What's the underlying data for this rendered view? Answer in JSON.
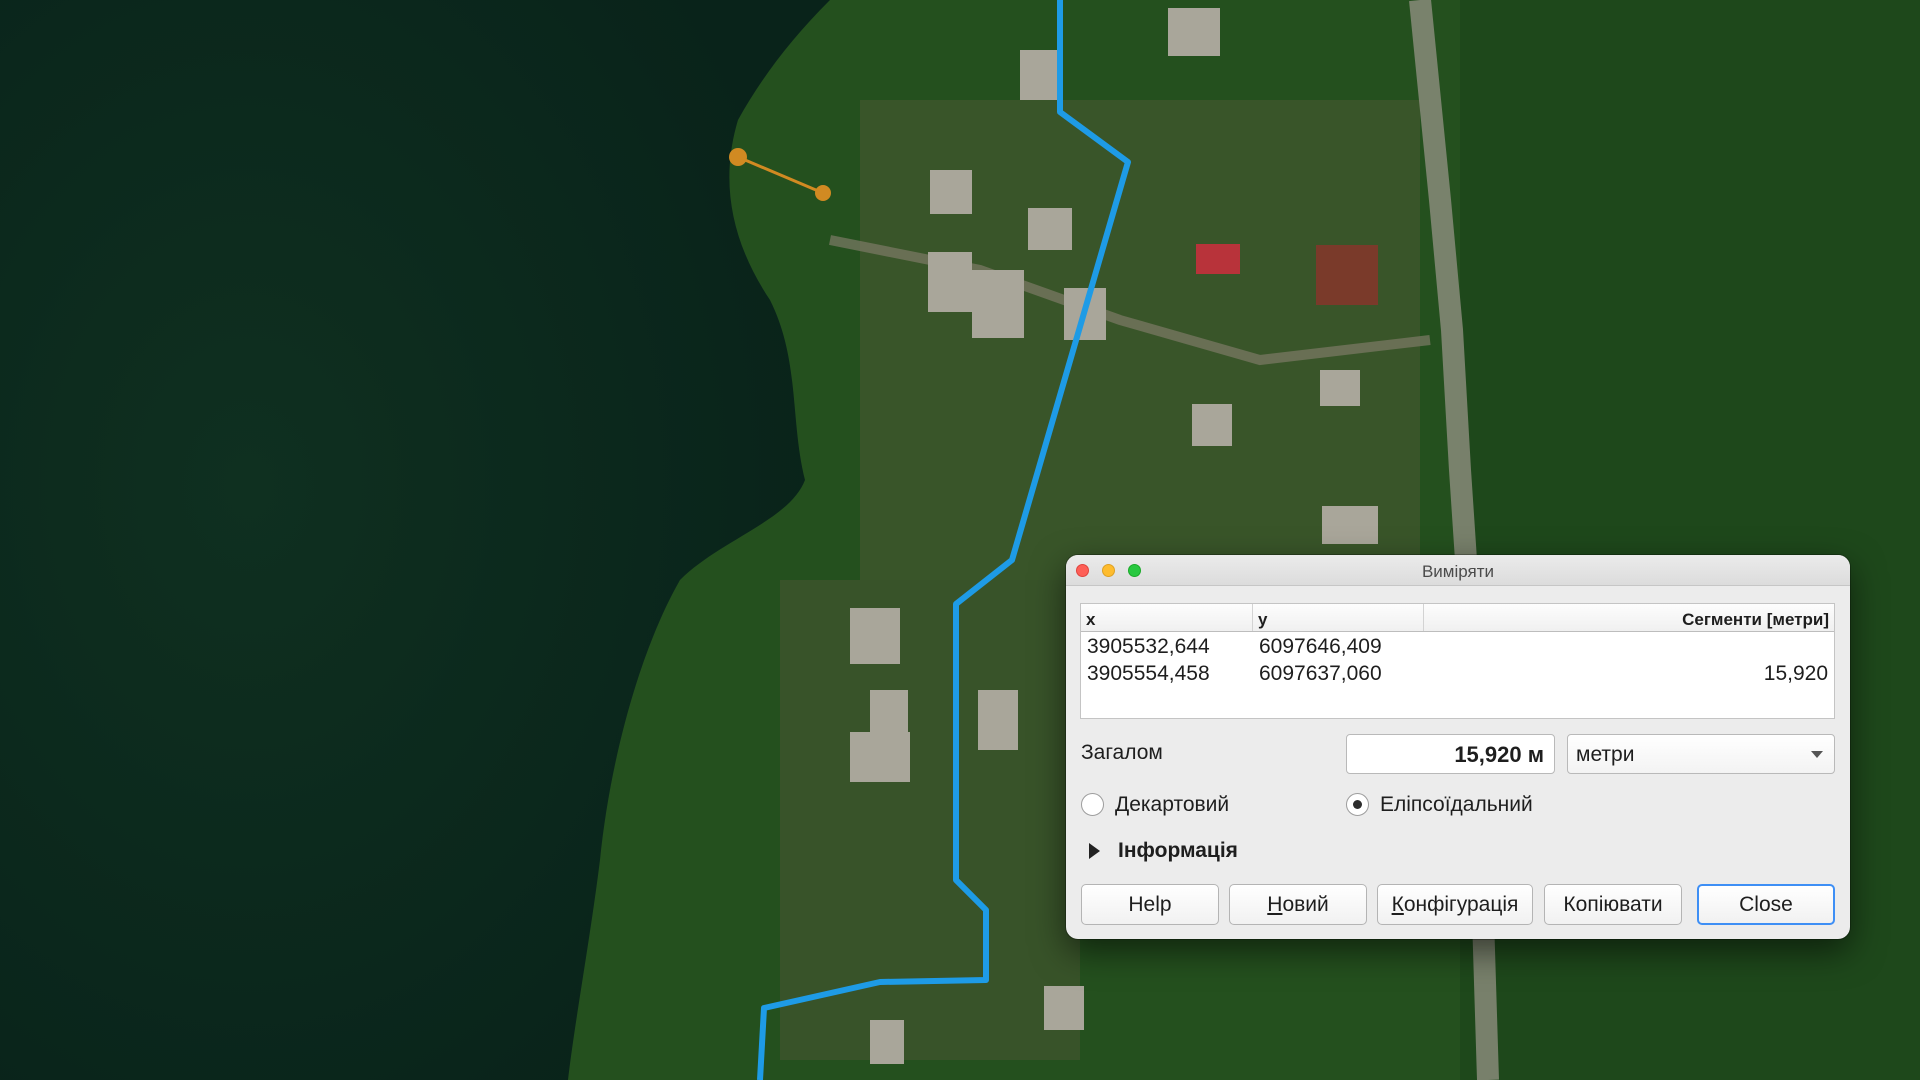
{
  "app": {
    "window_title": "Виміряти"
  },
  "map": {
    "water_color": "#0d2a1c",
    "vegetation_color": "#1f4a1c",
    "measure_line_color": "#1e9be6",
    "measure_points_color": "#d18a22"
  },
  "table": {
    "headers": {
      "x": "x",
      "y": "y",
      "segments": "Сегменти [метри]"
    },
    "rows": [
      {
        "x": "3905532,644",
        "y": "6097646,409",
        "segment": ""
      },
      {
        "x": "3905554,458",
        "y": "6097637,060",
        "segment": "15,920"
      }
    ]
  },
  "total": {
    "label": "Загалом",
    "value": "15,920 м",
    "units_selected": "метри"
  },
  "mode": {
    "cartesian_label": "Декартовий",
    "ellipsoidal_label": "Еліпсоїдальний",
    "selected": "ellipsoidal"
  },
  "info": {
    "label": "Інформація"
  },
  "buttons": {
    "help": "Help",
    "new_prefix": "Н",
    "new_rest": "овий",
    "config_prefix": "К",
    "config_rest": "онфігурація",
    "copy": "Копіювати",
    "close": "Close"
  }
}
